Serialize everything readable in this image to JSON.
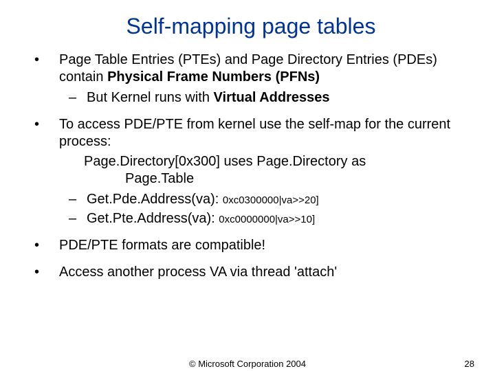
{
  "title": "Self-mapping page tables",
  "b1": {
    "line": "Page Table Entries (PTEs) and Page Directory Entries (PDEs) contain ",
    "bold": "Physical Frame Numbers (PFNs)",
    "sub_pre": "But Kernel runs with ",
    "sub_bold": "Virtual Addresses"
  },
  "b2": {
    "line": "To access PDE/PTE from kernel use the self-map for the current process:",
    "code_l1": "Page.Directory[0x300] uses Page.Directory as",
    "code_l2": "Page.Table",
    "sub1_label": "Get.Pde.Address(va): ",
    "sub1_code": "0xc0300000|va>>20]",
    "sub2_label": "Get.Pte.Address(va): ",
    "sub2_code": "0xc0000000|va>>10]"
  },
  "b3": "PDE/PTE formats are compatible!",
  "b4": "Access another process VA via thread 'attach'",
  "footer": {
    "copyright": "© Microsoft Corporation 2004",
    "page": "28"
  }
}
